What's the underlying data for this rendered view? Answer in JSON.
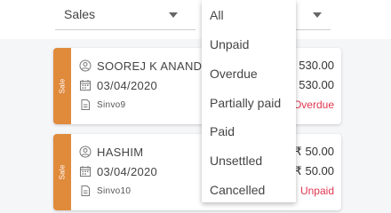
{
  "filters": {
    "type_select": {
      "value": "Sales"
    }
  },
  "menu": {
    "options": [
      "All",
      "Unpaid",
      "Overdue",
      "Partially paid",
      "Paid",
      "Unsettled",
      "Cancelled"
    ]
  },
  "cards": [
    {
      "strip_label": "Sale",
      "customer": "SOOREJ K ANAND",
      "date": "03/04/2020",
      "invoice": "Sinvo9",
      "amount_1": "530.00",
      "amount_2": "530.00",
      "status": "Overdue"
    },
    {
      "strip_label": "Sale",
      "customer": "HASHIM",
      "date": "03/04/2020",
      "invoice": "Sinvo10",
      "amount_1": "₹ 50.00",
      "amount_2": "₹ 50.00",
      "status": "Unpaid"
    }
  ],
  "colors": {
    "strip": "#e08a3c",
    "status": "#e0364f"
  },
  "icons": {
    "customer": "person-icon",
    "date": "calendar-icon",
    "invoice": "document-icon"
  }
}
